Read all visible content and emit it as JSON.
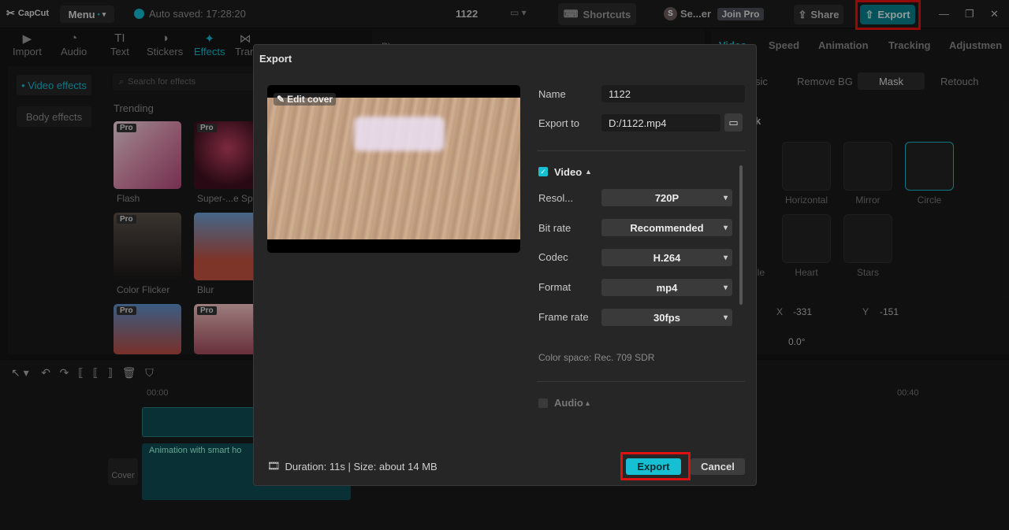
{
  "app": {
    "logo": "CapCut",
    "menu_label": "Menu",
    "autosave": "Auto saved: 17:28:20",
    "project_title": "1122",
    "shortcuts_label": "Shortcuts",
    "user_label": "Se...er",
    "avatar_initial": "S",
    "join_pro_label": "Join Pro",
    "share_label": "Share",
    "export_label": "Export"
  },
  "left_tools": [
    {
      "label": "Import"
    },
    {
      "label": "Audio"
    },
    {
      "label": "Text"
    },
    {
      "label": "Stickers"
    },
    {
      "label": "Effects"
    },
    {
      "label": "Tran"
    }
  ],
  "left_sidebar": {
    "video_effects": "• Video effects",
    "body_effects": "Body effects"
  },
  "effects": {
    "search_placeholder": "Search for effects",
    "trending_label": "Trending",
    "items": [
      {
        "label": "Flash",
        "pro": "Pro"
      },
      {
        "label": "Super-...e Sp",
        "pro": "Pro"
      },
      {
        "label": "Color Flicker",
        "pro": "Pro"
      },
      {
        "label": "Blur",
        "pro": ""
      },
      {
        "label": "",
        "pro": "Pro"
      },
      {
        "label": "",
        "pro": "Pro"
      }
    ]
  },
  "player": {
    "label": "Player"
  },
  "right_panel": {
    "tabs": [
      "Video",
      "Speed",
      "Animation",
      "Tracking",
      "Adjustmen"
    ],
    "subtabs": [
      "sic",
      "Remove BG",
      "Mask",
      "Retouch"
    ],
    "mask_header": "k",
    "masks": [
      {
        "label": "Horizontal"
      },
      {
        "label": "Mirror"
      },
      {
        "label": "Circle"
      },
      {
        "label": "gle"
      },
      {
        "label": "Heart"
      },
      {
        "label": "Stars"
      }
    ],
    "x_label": "X",
    "x_value": "-331",
    "y_label": "Y",
    "y_value": "-151",
    "rot_value": "0.0°"
  },
  "timeline": {
    "time_start": "00:00",
    "time_end": "00:40",
    "clip_label": "Animation with smart ho",
    "cover_label": "Cover"
  },
  "dialog": {
    "title": "Export",
    "edit_cover": "Edit cover",
    "name_label": "Name",
    "name_value": "1122",
    "export_to_label": "Export to",
    "export_to_value": "D:/1122.mp4",
    "video_section": "Video",
    "resolution_label": "Resol...",
    "resolution_value": "720P",
    "bitrate_label": "Bit rate",
    "bitrate_value": "Recommended",
    "codec_label": "Codec",
    "codec_value": "H.264",
    "format_label": "Format",
    "format_value": "mp4",
    "framerate_label": "Frame rate",
    "framerate_value": "30fps",
    "color_space": "Color space: Rec. 709 SDR",
    "audio_section": "Audio",
    "footer_info": "Duration: 11s | Size: about 14 MB",
    "export_button": "Export",
    "cancel_button": "Cancel"
  },
  "colors": {
    "accent": "#16bfd2",
    "highlight_box": "#e01010"
  }
}
